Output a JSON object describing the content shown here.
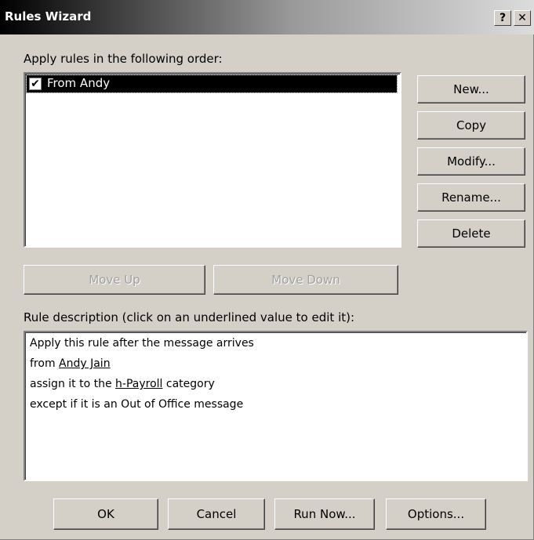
{
  "window": {
    "title": "Rules Wizard",
    "help_label": "?",
    "close_label": "✕"
  },
  "rules": {
    "heading": "Apply rules in the following order:",
    "items": [
      {
        "label": "From Andy",
        "checked": true,
        "selected": true
      }
    ]
  },
  "side_buttons": {
    "new": "New...",
    "copy": "Copy",
    "modify": "Modify...",
    "rename": "Rename...",
    "delete": "Delete"
  },
  "move_buttons": {
    "up": "Move Up",
    "down": "Move Down"
  },
  "description": {
    "heading": "Rule description (click on an underlined value to edit it):",
    "line1": "Apply this rule after the message arrives",
    "line2_prefix": "from ",
    "line2_link": "Andy Jain",
    "line3_prefix": "assign it to the ",
    "line3_link": "h-Payroll",
    "line3_suffix": " category",
    "line4": "except if it is an Out of Office message"
  },
  "bottom_buttons": {
    "ok": "OK",
    "cancel": "Cancel",
    "run_now": "Run Now...",
    "options": "Options..."
  },
  "icons": {
    "check": "✔"
  }
}
